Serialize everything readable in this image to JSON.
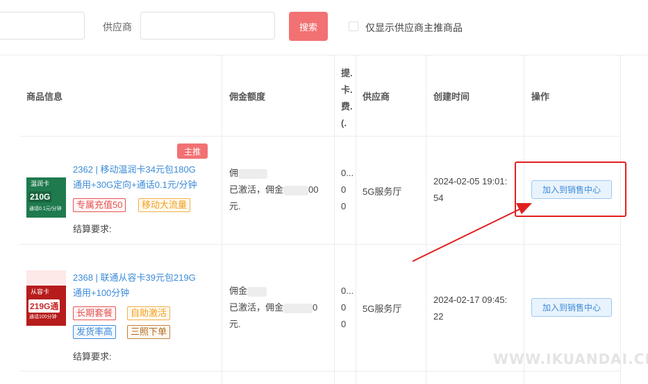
{
  "filter": {
    "left_input_value": "",
    "supplier_label": "供应商",
    "supplier_input_value": "",
    "search_button": "搜索",
    "only_main_checkbox_label": "仅显示供应商主推商品",
    "only_main_checked": false
  },
  "table": {
    "headers": {
      "product_info": "商品信息",
      "commission": "佣金额度",
      "card_fee": [
        "提.",
        "卡.",
        "费.",
        "(."
      ],
      "supplier": "供应商",
      "created_time": "创建时间",
      "action": "操作"
    },
    "rows": [
      {
        "badge": "主推",
        "thumb_chip": "温润卡",
        "thumb_big": "210G",
        "thumb_small": "通话0.1元/分钟",
        "title_line1": "2362 | 移动温润卡34元包180G",
        "title_line2": "通用+30G定向+通话0.1元/分钟",
        "tags": [
          "专属充值50",
          "移动大流量"
        ],
        "settle": "结算要求:",
        "commission_line1": "佣",
        "commission_line2": "已激活，佣金",
        "commission_line2_tail": "00",
        "commission_line3": "元.",
        "small_values": [
          "0...",
          "0",
          "0"
        ],
        "supplier": "5G服务厅",
        "created_line1": "2024-02-05 19:01:",
        "created_line2": "54",
        "action": "加入到销售中心"
      },
      {
        "thumb_chip": "从容卡",
        "thumb_big": "219G通",
        "thumb_small": "通话100分钟",
        "title_line1": "2368 | 联通从容卡39元包219G",
        "title_line2": "通用+100分钟",
        "tags": [
          "长期套餐",
          "自助激活",
          "发货率高",
          "三照下单"
        ],
        "settle": "结算要求:",
        "commission_line1": "佣金",
        "commission_line2": "已激活，佣金",
        "commission_line2_tail": "0",
        "commission_line3": "元.",
        "small_values": [
          "0...",
          "0",
          "0"
        ],
        "supplier": "5G服务厅",
        "created_line1": "2024-02-17 09:45:",
        "created_line2": "22",
        "action": "加入到销售中心"
      }
    ]
  },
  "watermark": "WWW.IKUANDAI.CN",
  "colors": {
    "primary_red": "#f27173",
    "link_blue": "#3c8bd8",
    "annotation_red": "#e02020"
  }
}
